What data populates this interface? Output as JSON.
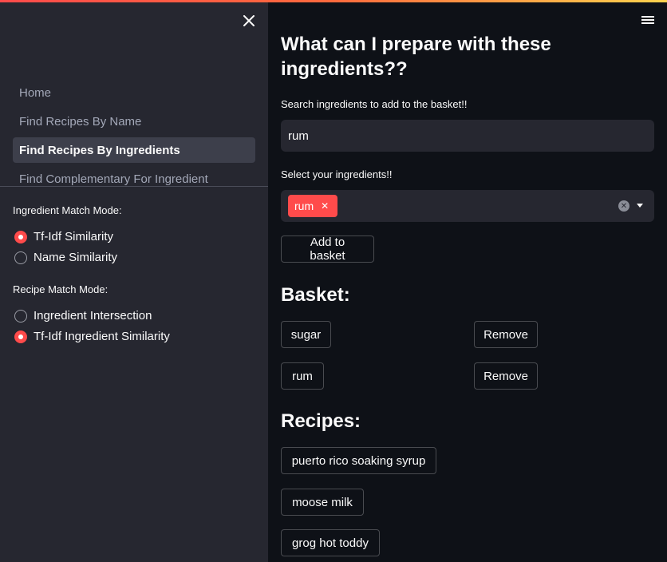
{
  "sidebar": {
    "nav": [
      {
        "label": "Home"
      },
      {
        "label": "Find Recipes By Name"
      },
      {
        "label": "Find Recipes By Ingredients"
      },
      {
        "label": "Find Complementary For Ingredient"
      }
    ],
    "ingredient_match_label": "Ingredient Match Mode:",
    "ingredient_match_options": [
      "Tf-Idf Similarity",
      "Name Similarity"
    ],
    "ingredient_match_selected": "Tf-Idf Similarity",
    "recipe_match_label": "Recipe Match Mode:",
    "recipe_match_options": [
      "Ingredient Intersection",
      "Tf-Idf Ingredient Similarity"
    ],
    "recipe_match_selected": "Tf-Idf Ingredient Similarity"
  },
  "main": {
    "title": "What can I prepare with these ingredients??",
    "search_label": "Search ingredients to add to the basket!!",
    "search_value": "rum",
    "select_label": "Select your ingredients!!",
    "selected_tags": [
      "rum"
    ],
    "add_button": "Add to basket",
    "basket_heading": "Basket:",
    "basket_items": [
      {
        "name": "sugar",
        "remove": "Remove"
      },
      {
        "name": "rum",
        "remove": "Remove"
      }
    ],
    "recipes_heading": "Recipes:",
    "recipes": [
      "puerto rico soaking syrup",
      "moose milk",
      "grog hot toddy"
    ]
  },
  "colors": {
    "accent": "#ff4b4b",
    "background": "#0e1117",
    "sidebar": "#262730",
    "input": "#262730"
  },
  "icons": {
    "close": "close-icon",
    "menu": "hamburger-menu-icon",
    "clear": "clear-all-icon",
    "dropdown": "chevron-down-icon",
    "tag_remove": "close-icon"
  }
}
